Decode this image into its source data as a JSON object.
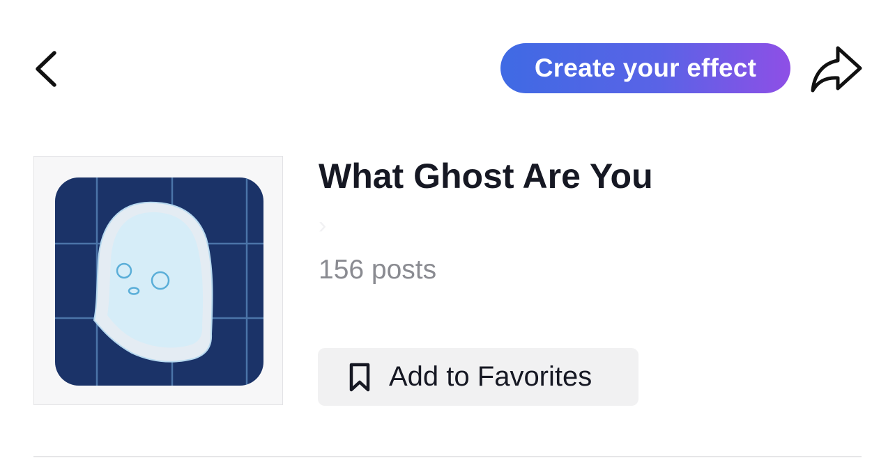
{
  "header": {
    "back_icon": "chevron-left-icon",
    "create_button_label": "Create your effect",
    "create_button_gradient": [
      "#3f6ae4",
      "#8e4fe6"
    ],
    "share_icon": "share-arrow-icon"
  },
  "effect": {
    "thumbnail_icon": "ghost-icon",
    "title": "What Ghost Are You",
    "creator": "",
    "creator_chevron": "›",
    "posts": "156 posts"
  },
  "actions": {
    "favorite_icon": "bookmark-icon",
    "favorite_label": "Add to Favorites"
  },
  "colors": {
    "text_primary": "#161823",
    "text_secondary": "#8a8b91",
    "thumb_bg": "#1b3368"
  }
}
